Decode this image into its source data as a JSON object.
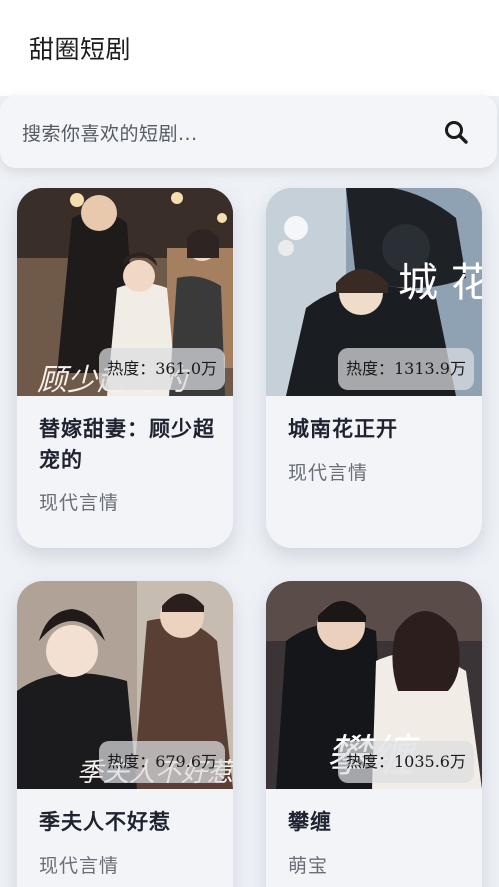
{
  "header": {
    "title": "甜圈短剧"
  },
  "search": {
    "placeholder": "搜索你喜欢的短剧..."
  },
  "dramas": [
    {
      "title": "替嫁甜妻：顾少超宠的",
      "genre": "现代言情",
      "heat": "热度：361.0万",
      "poster_overlay": "顾少超宠的"
    },
    {
      "title": "城南花正开",
      "genre": "现代言情",
      "heat": "热度：1313.9万",
      "poster_overlay": "城 花南 正开"
    },
    {
      "title": "季夫人不好惹",
      "genre": "现代言情",
      "heat": "热度：679.6万",
      "poster_overlay": "季夫人不好惹"
    },
    {
      "title": "攀缠",
      "genre": "萌宝",
      "heat": "热度：1035.6万",
      "poster_overlay": "攀缠"
    }
  ],
  "colors": {
    "page_bg": "#eef1f6",
    "card_bg": "#f2f4f8",
    "title_text": "#1f2330",
    "genre_text": "#6a6e77"
  }
}
